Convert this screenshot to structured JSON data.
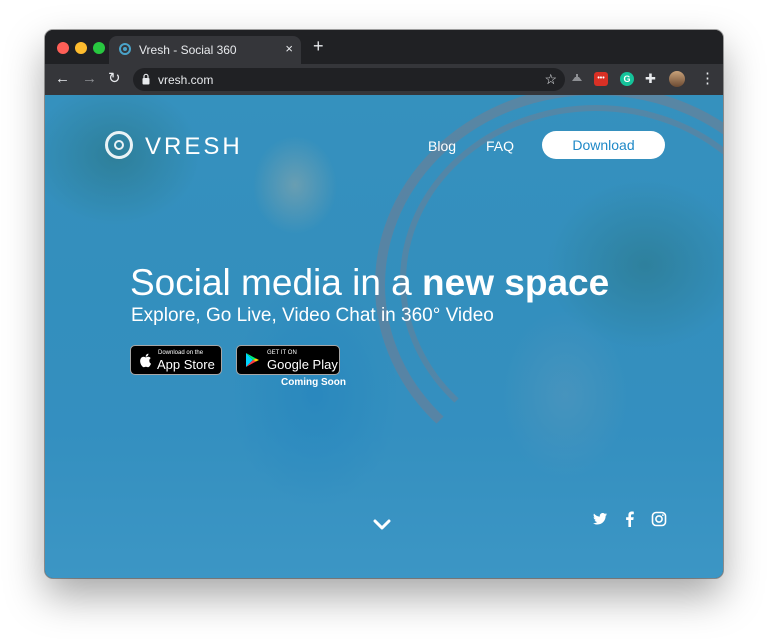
{
  "browser": {
    "tab_title": "Vresh - Social 360",
    "tab_close": "×",
    "new_tab": "+",
    "url": "vresh.com",
    "back": "←",
    "forward": "→",
    "reload": "↻",
    "bookmark_star": "☆",
    "menu": "⋮",
    "extensions": [
      "cast-icon",
      "red-extension-icon",
      "grammarly-icon",
      "puzzle-icon",
      "profile-avatar"
    ]
  },
  "site": {
    "logo_text": "VRESH",
    "nav": {
      "blog": "Blog",
      "faq": "FAQ",
      "download": "Download"
    },
    "hero": {
      "headline_regular": "Social media in a ",
      "headline_bold": "new space",
      "subhead": "Explore, Go Live, Video Chat in 360° Video"
    },
    "badges": {
      "apple_small": "Download on the",
      "apple_big": "App Store",
      "google_small": "GET IT ON",
      "google_big": "Google Play",
      "coming_soon": "Coming Soon"
    },
    "social": [
      "twitter-icon",
      "facebook-icon",
      "instagram-icon"
    ]
  },
  "colors": {
    "accent": "#1e88c7",
    "chrome_dark": "#202124",
    "chrome_toolbar": "#35363a"
  }
}
